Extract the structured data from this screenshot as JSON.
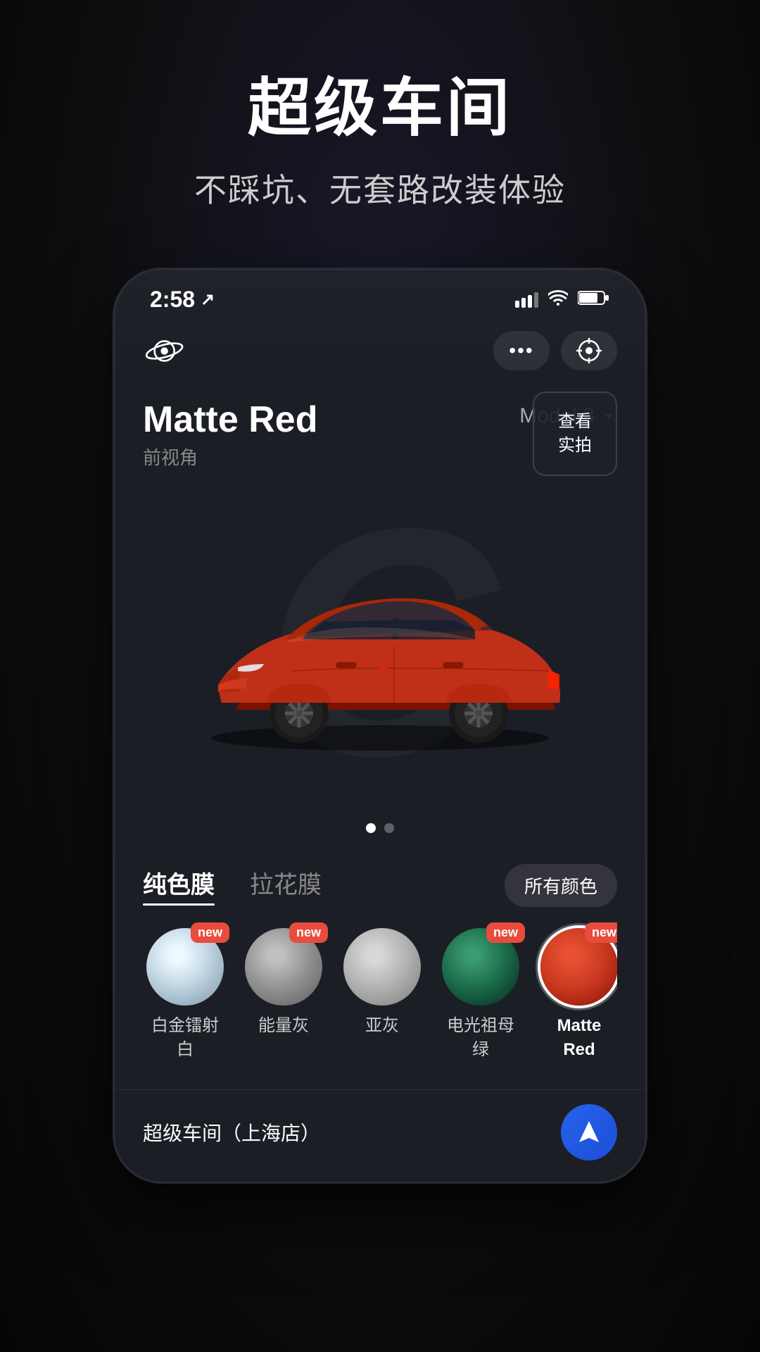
{
  "page": {
    "bg_color": "#0a0a0a",
    "title": "超级车间",
    "subtitle": "不踩坑、无套路改装体验"
  },
  "status_bar": {
    "time": "2:58",
    "location_icon": "↗"
  },
  "app_header": {
    "logo_text": "⊘",
    "more_btn_label": "•••",
    "scan_btn_label": "⊙"
  },
  "car_view": {
    "car_name": "Matte Red",
    "angle_label": "前视角",
    "model_label": "Model 3",
    "real_photo_btn_label": "查看\n实拍"
  },
  "page_indicator": {
    "active_dot": 0,
    "total_dots": 2
  },
  "film_tabs": {
    "active_tab": 0,
    "tabs": [
      {
        "label": "纯色膜",
        "id": "solid"
      },
      {
        "label": "拉花膜",
        "id": "pattern"
      }
    ],
    "all_colors_label": "所有颜色"
  },
  "color_swatches": [
    {
      "id": "platinum-white",
      "label": "白金镭射\n白",
      "label_line1": "白金镭射",
      "label_line2": "白",
      "is_new": true,
      "is_active": false,
      "color_style": "radial-gradient(circle at 40% 35%, #f0f8ff 10%, #c8dce8 40%, #a0b8c8 70%, #7898a8 100%)"
    },
    {
      "id": "energy-gray",
      "label": "能量灰",
      "label_line1": "能量灰",
      "label_line2": "",
      "is_new": true,
      "is_active": false,
      "color_style": "radial-gradient(circle at 40% 35%, #c0c0c0 10%, #909090 50%, #707070 80%, #505050 100%)"
    },
    {
      "id": "sub-gray",
      "label": "亚灰",
      "label_line1": "亚灰",
      "label_line2": "",
      "is_new": false,
      "is_active": false,
      "color_style": "radial-gradient(circle at 40% 35%, #d8d8d8 10%, #b0b0b0 50%, #909090 80%, #707070 100%)"
    },
    {
      "id": "electric-green",
      "label": "电光祖母\n绿",
      "label_line1": "电光祖母",
      "label_line2": "绿",
      "is_new": true,
      "is_active": false,
      "color_style": "radial-gradient(circle at 40% 35%, #2d7a5a 10%, #1a5a40 50%, #0e3d2a 80%, #071f15 100%)"
    },
    {
      "id": "matte-red",
      "label": "Matte\nRed",
      "label_line1": "Matte",
      "label_line2": "Red",
      "is_new": true,
      "is_active": true,
      "color_style": "radial-gradient(circle at 40% 35%, #e85030 10%, #c83820 50%, #a02010 80%, #801008 100%)"
    }
  ],
  "bottom_bar": {
    "shop_name": "超级车间（上海店）",
    "nav_icon_label": "navigation"
  },
  "labels": {
    "new_badge": "new"
  }
}
